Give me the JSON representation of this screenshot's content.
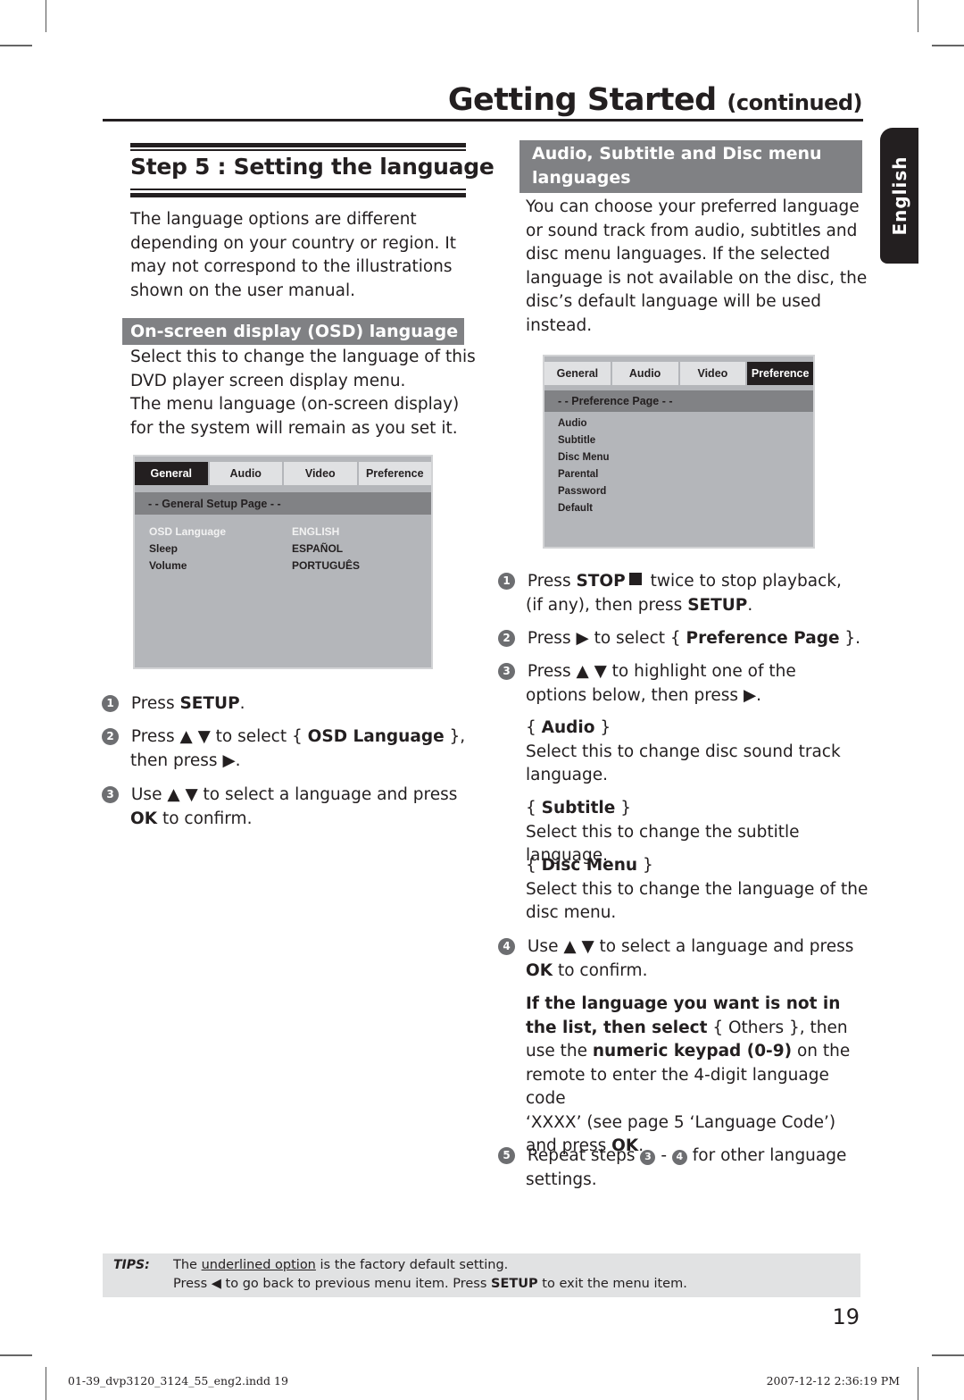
{
  "header": {
    "title": "Getting Started",
    "title_suffix": "(continued)",
    "side_tab": "English"
  },
  "left": {
    "step_title": "Step 5 : Setting the language",
    "intro_lines": [
      "The language options are different",
      "depending on your country or region. It",
      "may not correspond to the illustrations",
      "shown on the user manual."
    ],
    "section_title": "On-screen display (OSD) language",
    "section_lines": [
      "Select this to change the language of this",
      "DVD player screen display menu.",
      "The menu language (on-screen display)",
      "for the system will remain as you set it."
    ],
    "osd_menu": {
      "tabs": [
        "General",
        "Audio",
        "Video",
        "Preference"
      ],
      "active_tab": "General",
      "page_title": "- -  General Setup Page   - -",
      "items": [
        {
          "label": "OSD Language",
          "value": "ENGLISH",
          "highlighted": true
        },
        {
          "label": "Sleep",
          "value": "ESPAÑOL",
          "highlighted": false
        },
        {
          "label": "Volume",
          "value": "PORTUGUÊS",
          "highlighted": false
        }
      ]
    },
    "steps": [
      {
        "num": "1",
        "line1_a": "Press ",
        "line1_b": "SETUP",
        "line1_c": "."
      },
      {
        "num": "2",
        "line1_a": "Press ▲ ▼ to select { ",
        "line1_b": "OSD Language",
        "line1_c": " },",
        "line2": "then press ▶."
      },
      {
        "num": "3",
        "line1": "Use ▲ ▼ to select a language and press",
        "line2_a": "OK",
        "line2_b": " to confirm."
      }
    ]
  },
  "right": {
    "section_title_line1": "Audio, Subtitle and Disc menu",
    "section_title_line2": "languages",
    "intro_lines": [
      "You can choose your preferred language",
      "or sound track from audio, subtitles and",
      "disc menu languages. If the selected",
      "language is not available on the disc, the",
      "disc’s default language will be used",
      "instead."
    ],
    "osd_menu": {
      "tabs": [
        "General",
        "Audio",
        "Video",
        "Preference"
      ],
      "active_tab": "Preference",
      "page_title": "- -   Preference Page   - -",
      "items": [
        "Audio",
        "Subtitle",
        "Disc Menu",
        "Parental",
        "Password",
        "Default"
      ]
    },
    "steps": [
      {
        "num": "1",
        "a": "Press ",
        "b": "STOP",
        "c": " twice to stop playback,",
        "line2_a": "(if any), then press ",
        "line2_b": "SETUP",
        "line2_c": "."
      },
      {
        "num": "2",
        "a": "Press ▶ to select { ",
        "b": "Preference Page",
        "c": " }."
      },
      {
        "num": "3",
        "line1": "Press ▲ ▼ to highlight one of the",
        "line2": "options below, then press ▶."
      },
      {
        "num": "4",
        "line1": "Use ▲ ▼ to select a language and press",
        "line2_a": "OK",
        "line2_b": " to confirm."
      },
      {
        "num": "5",
        "a": "Repeat steps ",
        "ref1": "3",
        "mid": " - ",
        "ref2": "4",
        "c": " for other language",
        "line2": "settings."
      }
    ],
    "options": [
      {
        "name": "Audio",
        "desc_lines": [
          "Select this to change disc sound track",
          "language."
        ]
      },
      {
        "name": "Subtitle",
        "desc_lines": [
          "Select this to change the subtitle language."
        ]
      },
      {
        "name": "Disc Menu",
        "desc_lines": [
          "Select this to change the language of the",
          "disc menu."
        ]
      }
    ],
    "note": {
      "l1": "If the language you want is not in",
      "l2_bold": "the list, then select",
      "l2_rest": " { Others }, then",
      "l3_a": "use the ",
      "l3_bold": "numeric keypad (0-9)",
      "l3_c": " on the",
      "l4": "remote to enter the 4-digit language code",
      "l5": "‘XXXX’ (see page 5 ‘Language Code’)",
      "l6_a": "and press ",
      "l6_b": "OK",
      "l6_c": "."
    }
  },
  "tips": {
    "label": "TIPS:",
    "line1_a": "The ",
    "line1_u": "underlined option",
    "line1_c": " is the factory default setting.",
    "line2_a": "Press ",
    "line2_b": " to go back to previous menu item. Press ",
    "line2_c": "SETUP",
    "line2_d": " to exit the menu item."
  },
  "page_number": "19",
  "footer": {
    "file": "01-39_dvp3120_3124_55_eng2.indd   19",
    "timestamp": "2007-12-12   2:36:19 PM"
  }
}
